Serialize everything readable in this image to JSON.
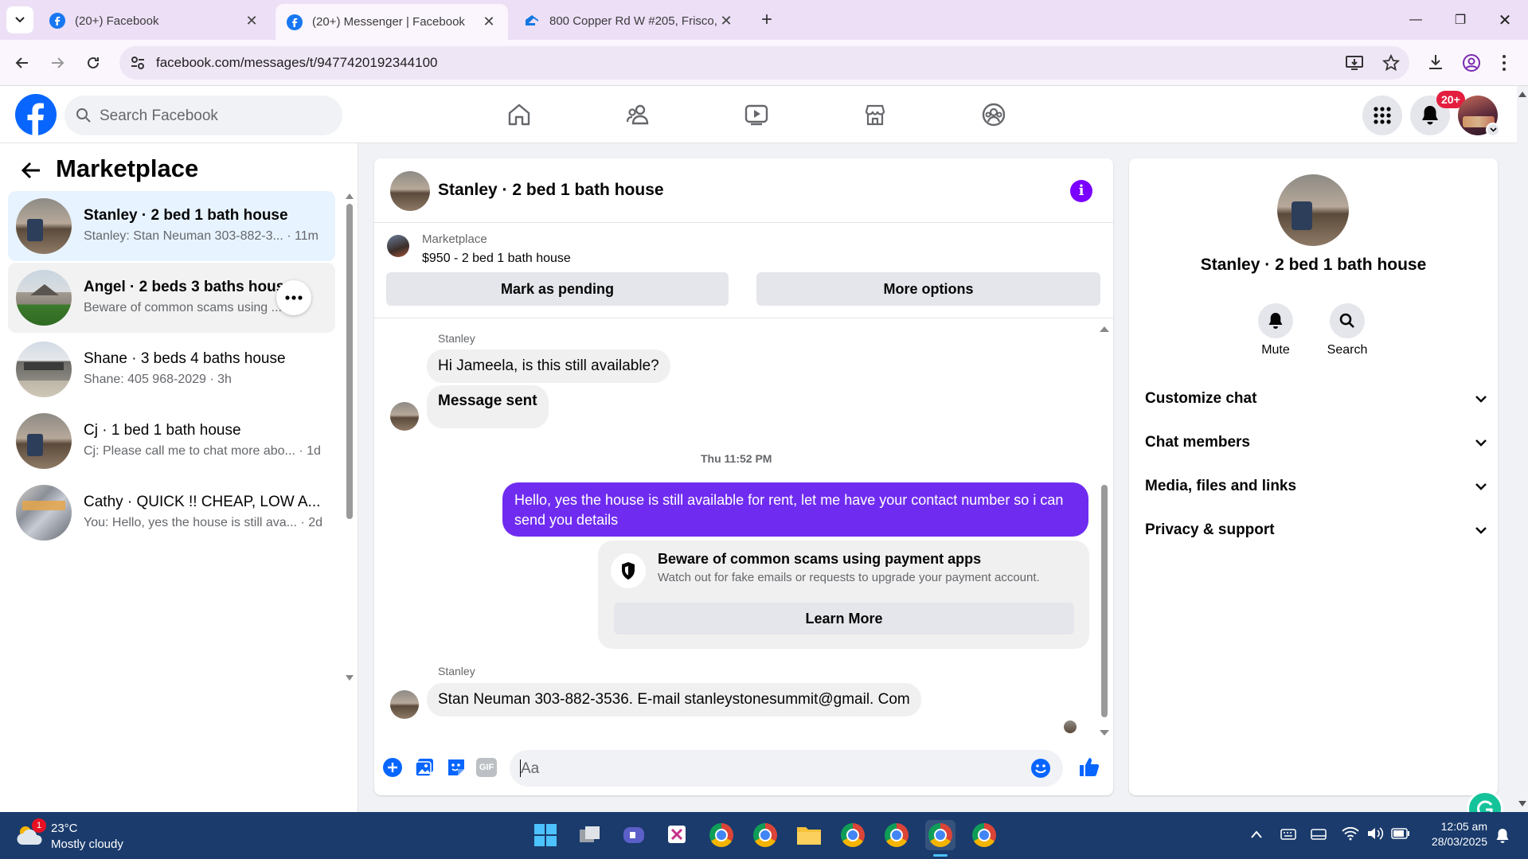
{
  "browser": {
    "tabs": [
      {
        "title": "(20+) Facebook",
        "active": false
      },
      {
        "title": "(20+) Messenger | Facebook",
        "active": true
      },
      {
        "title": "800 Copper Rd W #205, Frisco,",
        "active": false
      }
    ],
    "url": "facebook.com/messages/t/9477420192344100"
  },
  "fb_header": {
    "search_placeholder": "Search Facebook",
    "notification_badge": "20+"
  },
  "left_pane": {
    "title": "Marketplace",
    "conversations": [
      {
        "name": "Stanley · 2 bed 1 bath house",
        "preview": "Stanley: Stan Neuman 303-882-3... · 11m",
        "selected": true
      },
      {
        "name": "Angel · 2 beds 3 baths house",
        "preview": "Beware of common scams using ... m",
        "hovered": true
      },
      {
        "name": "Shane · 3 beds 4 baths house",
        "preview": "Shane: 405 968-2029 · 3h"
      },
      {
        "name": "Cj · 1 bed 1 bath house",
        "preview": "Cj: Please call me to chat more abo... · 1d"
      },
      {
        "name": "Cathy · QUICK !! CHEAP, LOW A...",
        "preview": "You: Hello, yes the house is still ava... · 2d"
      }
    ]
  },
  "chat": {
    "title": "Stanley · 2 bed 1 bath house",
    "listing_source": "Marketplace",
    "listing_title": "$950 - 2 bed 1 bath house",
    "mark_pending_label": "Mark as pending",
    "more_options_label": "More options",
    "messages": {
      "sender1": "Stanley",
      "msg1": "Hi Jameela, is this still available?",
      "msg2": "Message sent",
      "timestamp": "Thu 11:52 PM",
      "outgoing": "Hello, yes the house is still available for rent, let me have your contact number so i can send you details",
      "scam_title": "Beware of common scams using payment apps",
      "scam_body": "Watch out for fake emails or requests to upgrade your payment account.",
      "learn_more": "Learn More",
      "sender2": "Stanley",
      "msg3": "Stan Neuman 303-882-3536. E-mail stanleystonesummit@gmail. Com"
    },
    "composer_placeholder": "Aa",
    "accent_color": "#7a00ff",
    "outgoing_bubble_color": "#6f2cf0"
  },
  "info_pane": {
    "title": "Stanley · 2 bed 1 bath house",
    "mute_label": "Mute",
    "search_label": "Search",
    "sections": [
      "Customize chat",
      "Chat members",
      "Media, files and links",
      "Privacy & support"
    ]
  },
  "taskbar": {
    "weather_temp": "23°C",
    "weather_desc": "Mostly cloudy",
    "weather_badge": "1",
    "time": "12:05 am",
    "date": "28/03/2025"
  }
}
